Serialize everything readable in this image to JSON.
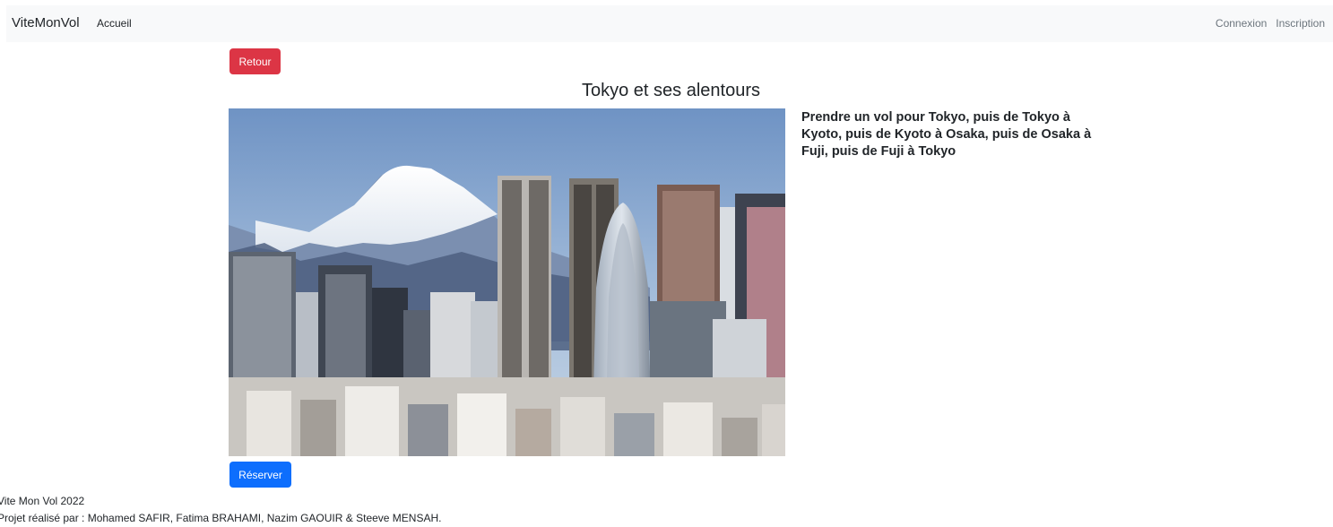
{
  "navbar": {
    "brand": "ViteMonVol",
    "home_link": "Accueil",
    "login_link": "Connexion",
    "signup_link": "Inscription"
  },
  "page": {
    "back_button": "Retour",
    "title": "Tokyo et ses alentours",
    "description": "Prendre un vol pour Tokyo, puis de Tokyo à Kyoto, puis de Kyoto à Osaka, puis de Osaka à Fuji, puis de Fuji à Tokyo",
    "book_button": "Réserver"
  },
  "footer": {
    "line1": "Vite Mon Vol 2022",
    "line2": "Projet réalisé par : Mohamed SAFIR, Fatima BRAHAMI, Nazim GAOUIR & Steeve MENSAH."
  },
  "colors": {
    "navbar_bg": "#f8f9fa",
    "danger": "#dc3545",
    "primary": "#0d6efd",
    "muted": "#6c757d"
  }
}
